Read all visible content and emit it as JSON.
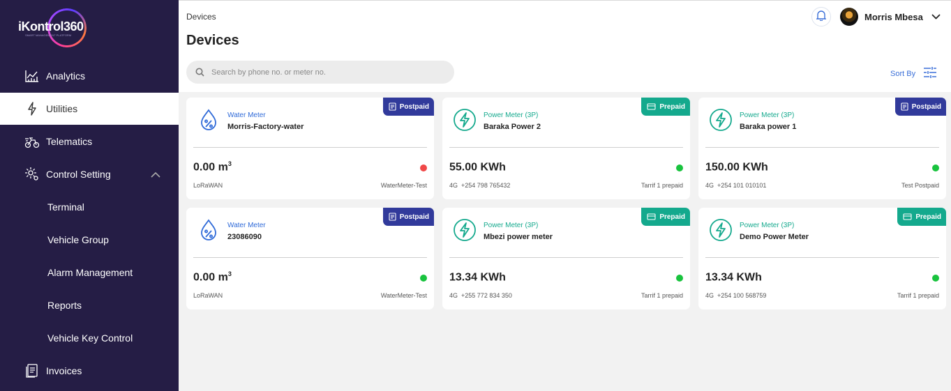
{
  "brand": {
    "name": "iKontrol360",
    "tagline": "SMART MANAGEMENT PLATFORM"
  },
  "sidebar": {
    "items": [
      {
        "label": "Analytics",
        "icon": "analytics-icon"
      },
      {
        "label": "Utilities",
        "icon": "lightning-icon",
        "active": true
      },
      {
        "label": "Telematics",
        "icon": "telematics-icon"
      },
      {
        "label": "Control Setting",
        "icon": "control-setting-icon",
        "expanded": true
      },
      {
        "label": "Terminal"
      },
      {
        "label": "Vehicle Group"
      },
      {
        "label": "Alarm Management"
      },
      {
        "label": "Reports"
      },
      {
        "label": "Vehicle Key Control"
      },
      {
        "label": "Invoices",
        "icon": "invoice-icon"
      }
    ]
  },
  "header": {
    "breadcrumb": "Devices",
    "title": "Devices",
    "user_name": "Morris Mbesa"
  },
  "search": {
    "placeholder": "Search by phone no. or meter no.",
    "value": ""
  },
  "sort": {
    "label": "Sort By"
  },
  "colors": {
    "sidebar_bg": "#251d45",
    "postpaid": "#313a9b",
    "prepaid": "#14a98d",
    "status_offline": "#f04848",
    "status_online": "#19c33e",
    "link": "#3a6fd8"
  },
  "devices": [
    {
      "type": "Water Meter",
      "name": "Morris-Factory-water",
      "billing": "Postpaid",
      "reading_value": "0.00 m",
      "reading_sup": "3",
      "network": "LoRaWAN",
      "phone": "",
      "tariff": "WaterMeter-Test",
      "status": "offline"
    },
    {
      "type": "Power Meter (3P)",
      "name": "Baraka Power 2",
      "billing": "Prepaid",
      "reading_value": "55.00 KWh",
      "reading_sup": "",
      "network": "4G",
      "phone": "+254  798 765432",
      "tariff": "Tarrif 1 prepaid",
      "status": "online"
    },
    {
      "type": "Power Meter (3P)",
      "name": "Baraka power 1",
      "billing": "Postpaid",
      "reading_value": "150.00 KWh",
      "reading_sup": "",
      "network": "4G",
      "phone": "+254  101 010101",
      "tariff": "Test Postpaid",
      "status": "online"
    },
    {
      "type": "Water Meter",
      "name": "23086090",
      "billing": "Postpaid",
      "reading_value": "0.00 m",
      "reading_sup": "3",
      "network": "LoRaWAN",
      "phone": "",
      "tariff": "WaterMeter-Test",
      "status": "online"
    },
    {
      "type": "Power Meter (3P)",
      "name": "Mbezi power meter",
      "billing": "Prepaid",
      "reading_value": "13.34 KWh",
      "reading_sup": "",
      "network": "4G",
      "phone": "+255  772 834 350",
      "tariff": "Tarrif 1 prepaid",
      "status": "online"
    },
    {
      "type": "Power Meter (3P)",
      "name": "Demo Power Meter",
      "billing": "Prepaid",
      "reading_value": "13.34 KWh",
      "reading_sup": "",
      "network": "4G",
      "phone": "+254  100 568759",
      "tariff": "Tarrif 1 prepaid",
      "status": "online"
    }
  ]
}
